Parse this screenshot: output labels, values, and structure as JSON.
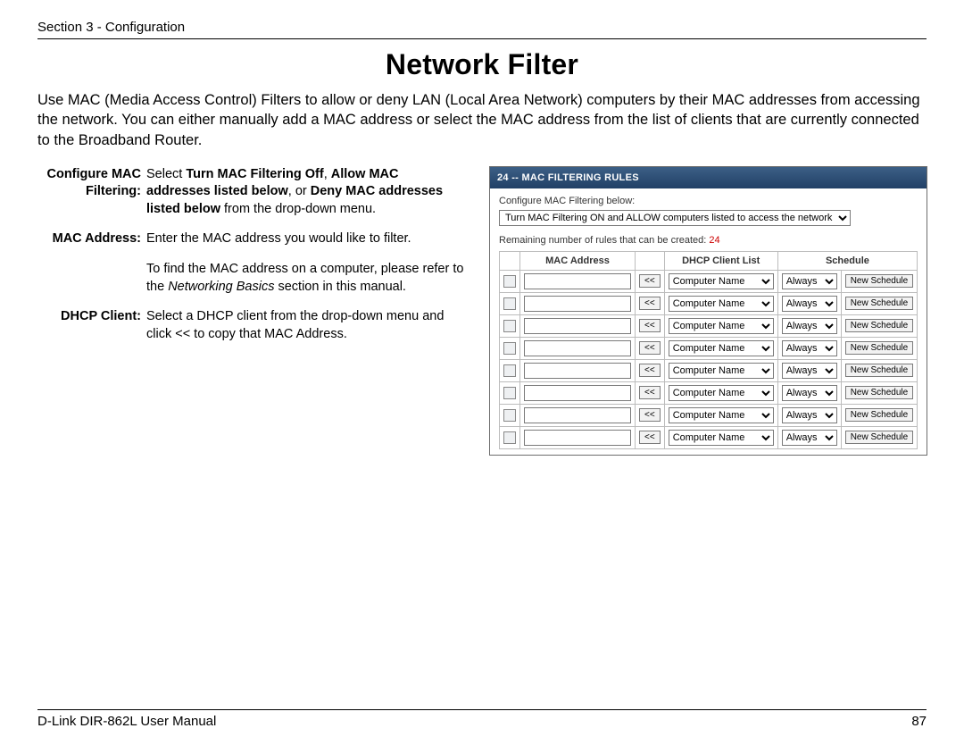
{
  "header": {
    "section": "Section 3 - Configuration"
  },
  "title": "Network Filter",
  "intro": "Use MAC (Media Access Control) Filters to allow or deny LAN (Local Area Network) computers by their MAC addresses from accessing the network. You can either manually add a MAC address or select the MAC address from the list of clients that are currently connected to the Broadband Router.",
  "defs": {
    "configure_term": "Configure MAC Filtering:",
    "configure_body_pre": "Select ",
    "configure_body_b1": "Turn MAC Filtering Off",
    "configure_body_sep1": ", ",
    "configure_body_b2": "Allow MAC addresses listed below",
    "configure_body_sep2": ", or ",
    "configure_body_b3": "Deny MAC addresses listed below",
    "configure_body_post": " from the drop-down menu.",
    "mac_term": "MAC Address:",
    "mac_body_p1": "Enter the MAC address you would like to filter.",
    "mac_body_p2a": "To find the MAC address on a computer, please refer to the ",
    "mac_body_p2i": "Networking Basics",
    "mac_body_p2b": " section in this manual.",
    "dhcp_term": "DHCP Client:",
    "dhcp_body": "Select a DHCP client from the drop-down menu and click << to copy that MAC Address."
  },
  "panel": {
    "header": "24 -- MAC FILTERING RULES",
    "cfg_label": "Configure MAC Filtering below:",
    "cfg_select": "Turn MAC Filtering ON and ALLOW computers listed to access the network",
    "remaining_pre": "Remaining number of rules that can be created: ",
    "remaining_num": "24",
    "th_mac": "MAC Address",
    "th_dhcp": "DHCP Client List",
    "th_sched": "Schedule",
    "copy_btn": "<<",
    "computer_name": "Computer Name",
    "always": "Always",
    "new_schedule": "New Schedule",
    "row_count": 8
  },
  "footer": {
    "left": "D-Link DIR-862L User Manual",
    "right": "87"
  }
}
